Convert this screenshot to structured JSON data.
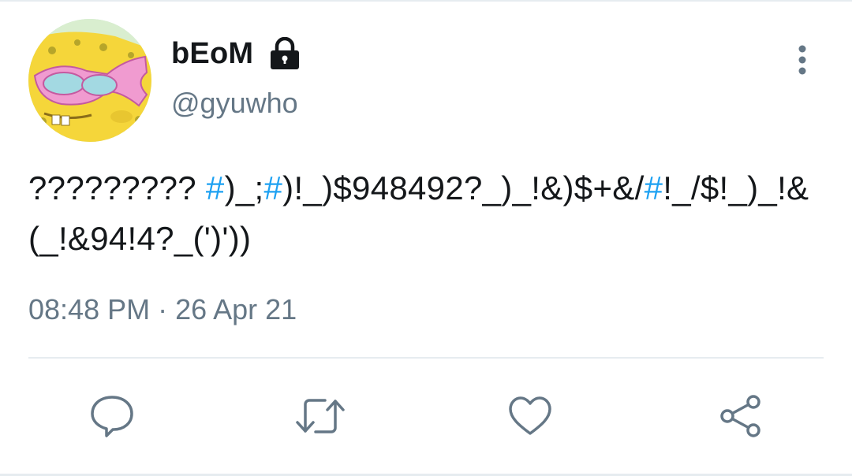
{
  "user": {
    "display_name": "bEoM",
    "handle": "@gyuwho",
    "avatar_icon": "spongebob-avatar",
    "protected_icon": "lock-icon"
  },
  "tweet": {
    "text_parts": [
      {
        "text": "????????? ",
        "type": "text"
      },
      {
        "text": "#",
        "type": "hashtag"
      },
      {
        "text": ")_;",
        "type": "text"
      },
      {
        "text": "#",
        "type": "hashtag"
      },
      {
        "text": ")!_)$948492?_)_!&)$+&/",
        "type": "text"
      },
      {
        "text": "#",
        "type": "hashtag"
      },
      {
        "text": "!_/$!_)_!&(_!&94!4?_(')'))",
        "type": "text"
      }
    ],
    "timestamp": "08:48 PM · 26 Apr 21"
  },
  "actions": {
    "reply_icon": "reply-icon",
    "retweet_icon": "retweet-icon",
    "like_icon": "heart-icon",
    "share_icon": "share-icon",
    "more_icon": "more-vertical-icon"
  },
  "colors": {
    "text": "#14171a",
    "secondary": "#657786",
    "link": "#1da1f2",
    "divider": "#e6ecf0"
  }
}
